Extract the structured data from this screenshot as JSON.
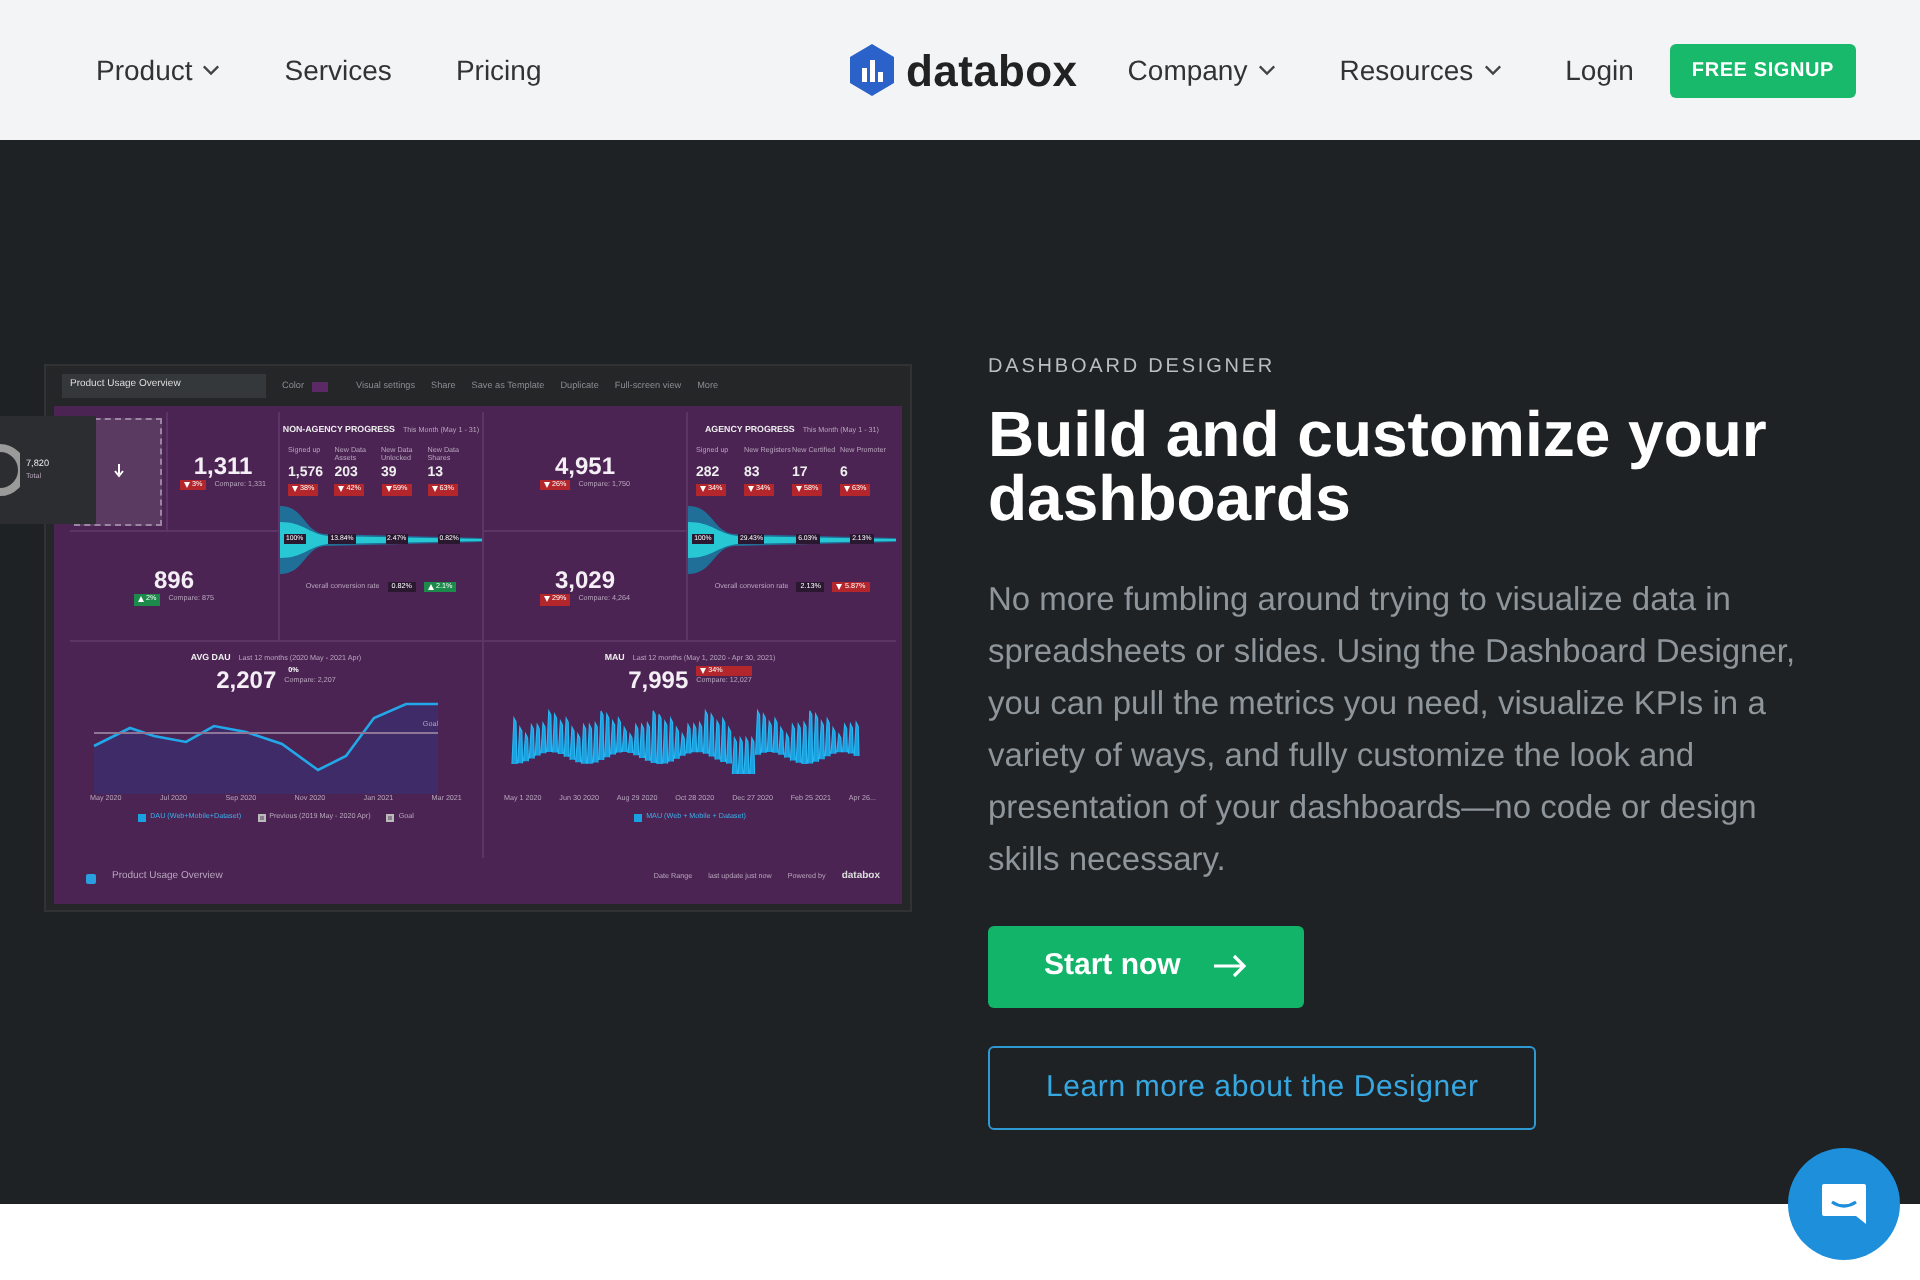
{
  "nav": {
    "left_links": [
      {
        "label": "Product",
        "dropdown": true
      },
      {
        "label": "Services",
        "dropdown": false
      },
      {
        "label": "Pricing",
        "dropdown": false
      }
    ],
    "logo": "databox",
    "right_links": [
      {
        "label": "Company",
        "dropdown": true
      },
      {
        "label": "Resources",
        "dropdown": true
      },
      {
        "label": "Login",
        "dropdown": false
      }
    ],
    "signup": "FREE SIGNUP"
  },
  "preview": {
    "toolbar": {
      "title": "Product Usage Overview",
      "color_label": "Color",
      "actions": [
        "Visual settings",
        "Share",
        "Save as Template",
        "Duplicate",
        "Full-screen view",
        "More"
      ]
    },
    "floating_widget": {
      "value": "7,820",
      "label": "Total"
    },
    "tiles": [
      {
        "value": "1,311",
        "change": "3%",
        "decrease": true,
        "compare": "Compare: 1,331"
      },
      {
        "value": "4,951",
        "change": "26%",
        "decrease": true,
        "compare": "Compare: 1,750"
      },
      {
        "value": "896",
        "change": "2%",
        "decrease": false,
        "compare": "Compare: 875"
      },
      {
        "value": "3,029",
        "change": "29%",
        "decrease": true,
        "compare": "Compare: 4,264"
      }
    ],
    "progress": [
      {
        "title": "NON-AGENCY PROGRESS",
        "period": "This Month (May 1 - 31)",
        "metrics": [
          {
            "label": "Signed up",
            "value": "1,576",
            "change": "38%"
          },
          {
            "label": "New Data Assets",
            "value": "203",
            "change": "42%"
          },
          {
            "label": "New Data Unlocked",
            "value": "39",
            "change": "59%"
          },
          {
            "label": "New Data Shares",
            "value": "13",
            "change": "63%"
          }
        ],
        "funnel": [
          "100%",
          "13.84%",
          "2.47%",
          "0.82%"
        ],
        "conversion_label": "Overall conversion rate",
        "conversion": "0.82%",
        "conversion_change": "2.1%",
        "conversion_decrease": false
      },
      {
        "title": "AGENCY PROGRESS",
        "period": "This Month (May 1 - 31)",
        "metrics": [
          {
            "label": "Signed up",
            "value": "282",
            "change": "34%"
          },
          {
            "label": "New Registers",
            "value": "83",
            "change": "34%"
          },
          {
            "label": "New Certified",
            "value": "17",
            "change": "58%"
          },
          {
            "label": "New Promoter",
            "value": "6",
            "change": "63%"
          }
        ],
        "funnel": [
          "100%",
          "29.43%",
          "6.03%",
          "2.13%"
        ],
        "conversion_label": "Overall conversion rate",
        "conversion": "2.13%",
        "conversion_change": "5.87%",
        "conversion_decrease": true
      }
    ],
    "charts": [
      {
        "kind": "line",
        "title": "AVG DAU",
        "period": "Last 12 months (2020 May - 2021 Apr)",
        "value": "2,207",
        "change": "0%",
        "compare": "Compare: 2,207",
        "goal_label": "Goal",
        "x_labels": [
          "May 2020",
          "Jul 2020",
          "Sep 2020",
          "Nov 2020",
          "Jan 2021",
          "Mar 2021"
        ],
        "legend": [
          {
            "label": "DAU (Web+Mobile+Dataset)",
            "checked": true
          },
          {
            "label": "Previous (2019 May - 2020 Apr)",
            "checked": false
          },
          {
            "label": "Goal",
            "checked": false
          }
        ]
      },
      {
        "kind": "spikes",
        "title": "MAU",
        "period": "Last 12 months (May 1, 2020 - Apr 30, 2021)",
        "value": "7,995",
        "change": "34%",
        "decrease": true,
        "compare": "Compare: 12,027",
        "x_labels": [
          "May 1 2020",
          "Jun 30 2020",
          "Aug 29 2020",
          "Oct 28 2020",
          "Dec 27 2020",
          "Feb 25 2021",
          "Apr 26..."
        ],
        "legend": [
          {
            "label": "MAU (Web + Mobile + Dataset)",
            "checked": true
          }
        ]
      }
    ],
    "footer": {
      "title": "Product Usage Overview",
      "date_range": "Date Range",
      "updated": "last update just now",
      "powered": "Powered by",
      "brand": "databox"
    }
  },
  "hero": {
    "eyebrow": "DASHBOARD DESIGNER",
    "title": "Build and customize your dashboards",
    "body": "No more fumbling around trying to visualize data in spreadsheets or slides. Using the Dashboard Designer, you can pull the metrics you need, visualize KPIs in a variety of ways, and fully customize the look and presentation of your dashboards—no code or design skills necessary.",
    "primary": "Start now",
    "secondary": "Learn more about the Designer"
  }
}
